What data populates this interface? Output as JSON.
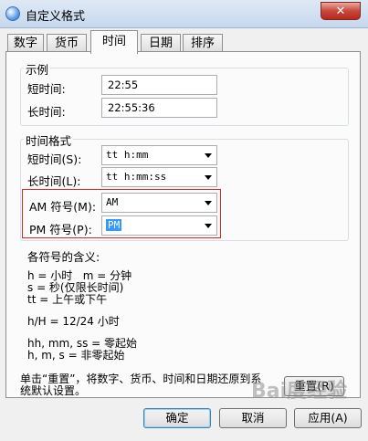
{
  "window": {
    "title": "自定义格式",
    "close_glyph": "✕"
  },
  "tabs": [
    {
      "label": "数字",
      "active": false
    },
    {
      "label": "货币",
      "active": false
    },
    {
      "label": "时间",
      "active": true
    },
    {
      "label": "日期",
      "active": false
    },
    {
      "label": "排序",
      "active": false
    }
  ],
  "example": {
    "legend": "示例",
    "short_label": "短时间:",
    "short_value": "22:55",
    "long_label": "长时间:",
    "long_value": "22:55:36"
  },
  "format": {
    "legend": "时间格式",
    "short_label": "短时间(S):",
    "short_value": "tt h:mm",
    "long_label": "长时间(L):",
    "long_value": "tt h:mm:ss",
    "am_label": "AM 符号(M):",
    "am_value": "AM",
    "pm_label": "PM 符号(P):",
    "pm_value": "PM"
  },
  "notes": {
    "heading": "各符号的含义:",
    "line1": "h = 小时   m = 分钟",
    "line2": "s = 秒(仅限长时间)",
    "line3": "tt = 上午或下午",
    "line4": "h/H = 12/24 小时",
    "line5": "hh, mm, ss = 零起始",
    "line6": "h, m, s = 非零起始"
  },
  "reset": {
    "text_line1": "单击“重置”，将数字、货币、时间和日期还原到系",
    "text_line2": "统默认设置。",
    "button_label": "重置(R)"
  },
  "footer": {
    "ok_label": "确定",
    "cancel_label": "取消",
    "apply_label": "应用(A)"
  },
  "watermark": {
    "text": "Bai度经验"
  },
  "colors": {
    "highlight_box": "#d62a2a",
    "selection": "#3399ff",
    "default_button": "#3c7fb1"
  }
}
